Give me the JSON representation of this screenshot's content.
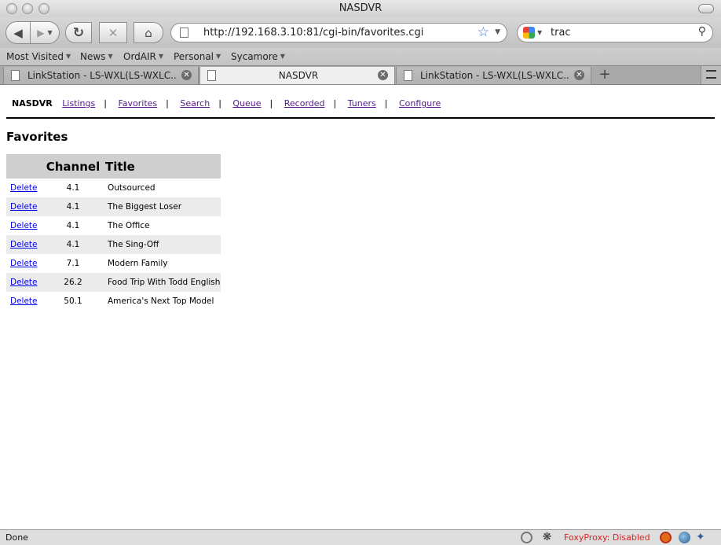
{
  "window": {
    "title": "NASDVR"
  },
  "toolbar": {
    "url": "http://192.168.3.10:81/cgi-bin/favorites.cgi",
    "search_value": "trac"
  },
  "bookmarks": [
    "Most Visited",
    "News",
    "OrdAIR",
    "Personal",
    "Sycamore"
  ],
  "tabs": [
    {
      "title": "LinkStation - LS-WXL(LS-WXLC..."
    },
    {
      "title": "NASDVR"
    },
    {
      "title": "LinkStation - LS-WXL(LS-WXLC..."
    }
  ],
  "page": {
    "brand": "NASDVR",
    "nav": [
      "Listings",
      "Favorites",
      "Search",
      "Queue",
      "Recorded",
      "Tuners",
      "Configure"
    ],
    "nav_separator": "|",
    "heading": "Favorites",
    "table": {
      "headers": [
        "",
        "Channel",
        "Title"
      ],
      "delete_label": "Delete",
      "rows": [
        {
          "channel": "4.1",
          "title": "Outsourced"
        },
        {
          "channel": "4.1",
          "title": "The Biggest Loser"
        },
        {
          "channel": "4.1",
          "title": "The Office"
        },
        {
          "channel": "4.1",
          "title": "The Sing-Off"
        },
        {
          "channel": "7.1",
          "title": "Modern Family"
        },
        {
          "channel": "26.2",
          "title": "Food Trip With Todd English"
        },
        {
          "channel": "50.1",
          "title": "America's Next Top Model"
        }
      ]
    }
  },
  "status": {
    "text": "Done",
    "foxyproxy": "FoxyProxy: Disabled"
  },
  "colors": {
    "link": "#0000ee",
    "visited": "#551a8b",
    "foxy": "#d22222",
    "header_bg": "#cfcfcf",
    "alt_row": "#ebebeb"
  },
  "icons": [
    "back-icon",
    "forward-icon",
    "reload-icon",
    "stop-icon",
    "home-icon",
    "bookmark-star-icon",
    "google-icon",
    "magnifier-icon",
    "close-tab-icon",
    "new-tab-icon"
  ]
}
